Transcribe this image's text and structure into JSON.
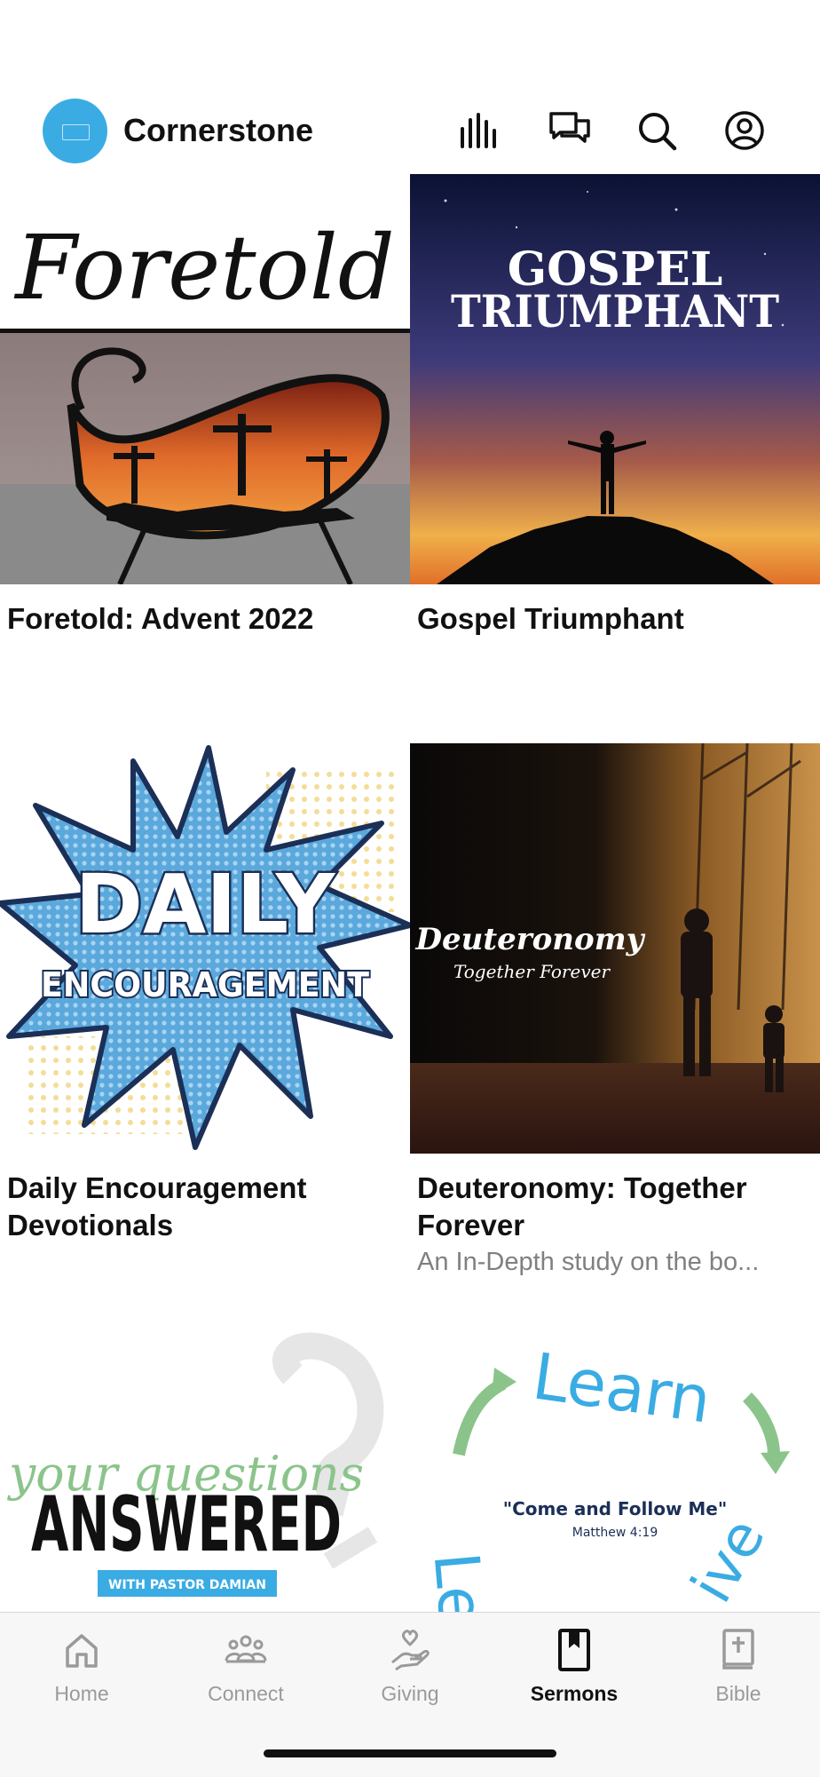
{
  "header": {
    "org_name": "Cornerstone",
    "icons": [
      "live-icon",
      "chat-icon",
      "search-icon",
      "profile-icon"
    ]
  },
  "sermon_series": [
    {
      "title": "Foretold: Advent 2022",
      "subtitle": "",
      "art_text": [
        "Foretold"
      ]
    },
    {
      "title": "Gospel Triumphant",
      "subtitle": "",
      "art_text": [
        "GOSPEL",
        "TRIUMPHANT"
      ]
    },
    {
      "title": "Daily Encouragement Devotionals",
      "subtitle": "",
      "art_text": [
        "DAILY",
        "ENCOURAGEMENT"
      ]
    },
    {
      "title": "Deuteronomy: Together Forever",
      "subtitle": "An In-Depth study on the bo...",
      "art_text": [
        "Deuteronomy",
        "Together Forever"
      ]
    },
    {
      "title": "",
      "subtitle": "",
      "art_text": [
        "your questions",
        "ANSWERED",
        "WITH PASTOR DAMIAN"
      ]
    },
    {
      "title": "",
      "subtitle": "",
      "art_text": [
        "Learn",
        "\"Come and Follow Me\"",
        "Matthew 4:19",
        "Le",
        "ive"
      ]
    }
  ],
  "tabs": [
    {
      "label": "Home",
      "icon": "home-icon",
      "active": false
    },
    {
      "label": "Connect",
      "icon": "people-icon",
      "active": false
    },
    {
      "label": "Giving",
      "icon": "giving-icon",
      "active": false
    },
    {
      "label": "Sermons",
      "icon": "bookmark-book-icon",
      "active": true
    },
    {
      "label": "Bible",
      "icon": "bible-icon",
      "active": false
    }
  ],
  "colors": {
    "brand": "#3aace3",
    "active_tab": "#111111",
    "inactive_tab": "#9a9a9a"
  }
}
